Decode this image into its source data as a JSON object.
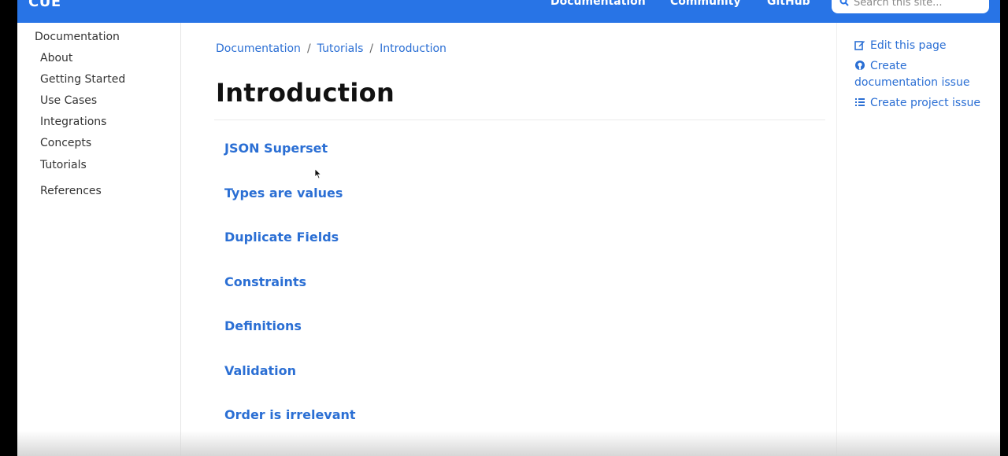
{
  "header": {
    "brand": "CUE",
    "nav": [
      "Documentation",
      "Community",
      "GitHub"
    ],
    "search_placeholder": "Search this site..."
  },
  "sidebar": {
    "title": "Documentation",
    "items": [
      "About",
      "Getting Started",
      "Use Cases",
      "Integrations",
      "Concepts",
      "Tutorials",
      "References"
    ]
  },
  "breadcrumb": [
    "Documentation",
    "Tutorials",
    "Introduction"
  ],
  "page": {
    "title": "Introduction",
    "links": [
      "JSON Superset",
      "Types are values",
      "Duplicate Fields",
      "Constraints",
      "Definitions",
      "Validation",
      "Order is irrelevant"
    ]
  },
  "rightbar": {
    "edit": "Edit this page",
    "create_doc": "Create documentation issue",
    "create_project": "Create project issue"
  },
  "colors": {
    "header_bg": "#2874e6",
    "link": "#2b6fd4"
  }
}
